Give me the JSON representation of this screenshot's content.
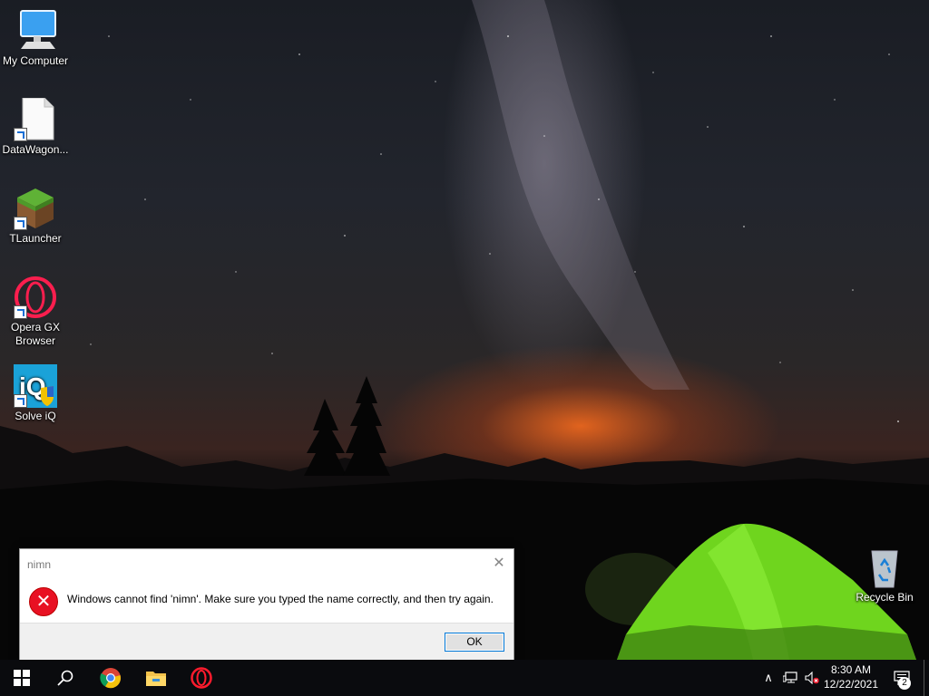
{
  "desktop": {
    "icons": [
      {
        "label": "My Computer",
        "icon": "computer-icon"
      },
      {
        "label": "DataWagon...",
        "icon": "document-icon"
      },
      {
        "label": "TLauncher",
        "icon": "grass-block-icon"
      },
      {
        "label": "Opera GX Browser",
        "icon": "opera-gx-icon"
      },
      {
        "label": "Solve iQ",
        "icon": "solve-iq-icon"
      },
      {
        "label": "Recycle Bin",
        "icon": "recycle-bin-icon"
      }
    ]
  },
  "dialog": {
    "title": "nimn",
    "message": "Windows cannot find 'nimn'. Make sure you typed the name correctly, and then try again.",
    "ok_label": "OK",
    "close_glyph": "✕",
    "error_glyph": "✕"
  },
  "taskbar": {
    "pinned": [
      {
        "icon": "windows-start-icon"
      },
      {
        "icon": "search-icon"
      },
      {
        "icon": "chrome-icon"
      },
      {
        "icon": "file-explorer-icon"
      },
      {
        "icon": "opera-icon"
      }
    ],
    "tray": {
      "chevron": "∧",
      "time": "8:30 AM",
      "date": "12/22/2021",
      "notification_count": "2"
    }
  },
  "colors": {
    "error_red": "#e81123",
    "accent_blue": "#0078d7",
    "taskbar": "#0a0b0e"
  }
}
